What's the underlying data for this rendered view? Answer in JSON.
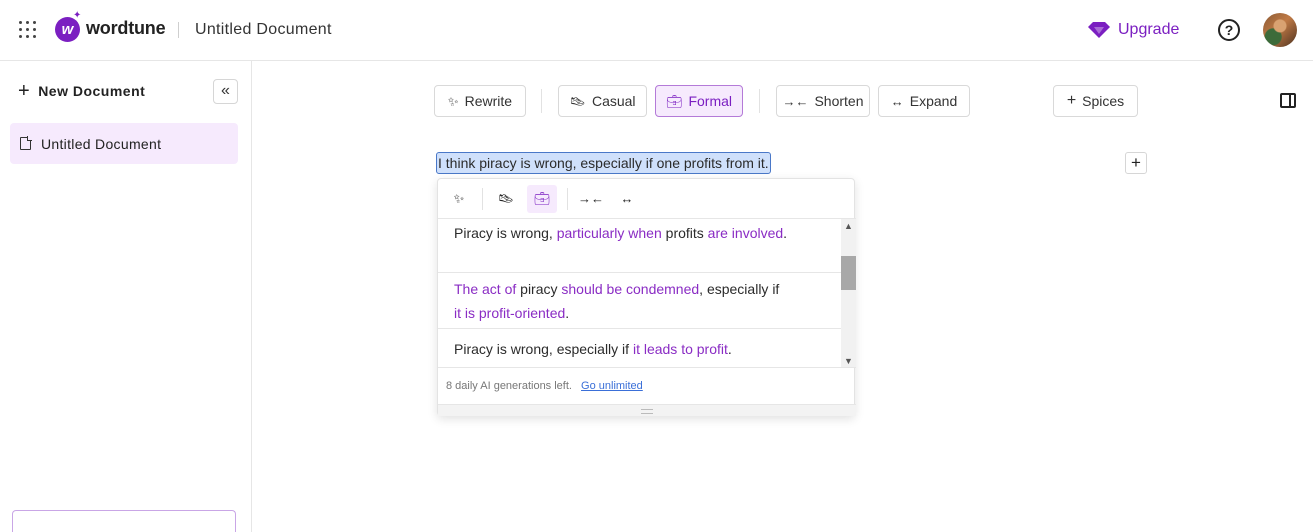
{
  "header": {
    "brand": "wordtune",
    "document_title": "Untitled Document",
    "upgrade_label": "Upgrade",
    "help_glyph": "?",
    "icons": {
      "apps": "apps-grid-icon",
      "upgrade": "diamond-icon",
      "help": "help-icon",
      "avatar": "user-avatar"
    }
  },
  "sidebar": {
    "new_document_label": "New Document",
    "collapse_glyph": "«",
    "documents": [
      {
        "label": "Untitled Document",
        "active": true
      }
    ]
  },
  "toolbar": {
    "rewrite_label": "Rewrite",
    "casual_label": "Casual",
    "formal_label": "Formal",
    "shorten_label": "Shorten",
    "expand_label": "Expand",
    "spices_label": "Spices",
    "active_tone": "Formal"
  },
  "editor": {
    "selected_text": "I think piracy is wrong, especially if one profits from it."
  },
  "suggestions": {
    "items": [
      [
        {
          "t": "Piracy is wrong, ",
          "hl": false
        },
        {
          "t": "particularly when",
          "hl": true
        },
        {
          "t": " profits ",
          "hl": false
        },
        {
          "t": "are involved",
          "hl": true
        },
        {
          "t": ".",
          "hl": false
        }
      ],
      [
        {
          "t": "The act of",
          "hl": true
        },
        {
          "t": " piracy ",
          "hl": false
        },
        {
          "t": "should be condemned",
          "hl": true
        },
        {
          "t": ", especially if ",
          "hl": false
        },
        {
          "t": "it is profit-oriented",
          "hl": true
        },
        {
          "t": ".",
          "hl": false
        }
      ],
      [
        {
          "t": "Piracy is wrong, especially if ",
          "hl": false
        },
        {
          "t": "it leads to profit",
          "hl": true
        },
        {
          "t": ".",
          "hl": false
        }
      ]
    ],
    "footer_text": "8 daily AI generations left.",
    "footer_link": "Go unlimited"
  },
  "colors": {
    "brand": "#7b1fc1",
    "highlight_text": "#8a2cc4",
    "active_bg": "#f6eafd",
    "selection_bg": "#cfe0fb",
    "link": "#3a6fd8"
  }
}
